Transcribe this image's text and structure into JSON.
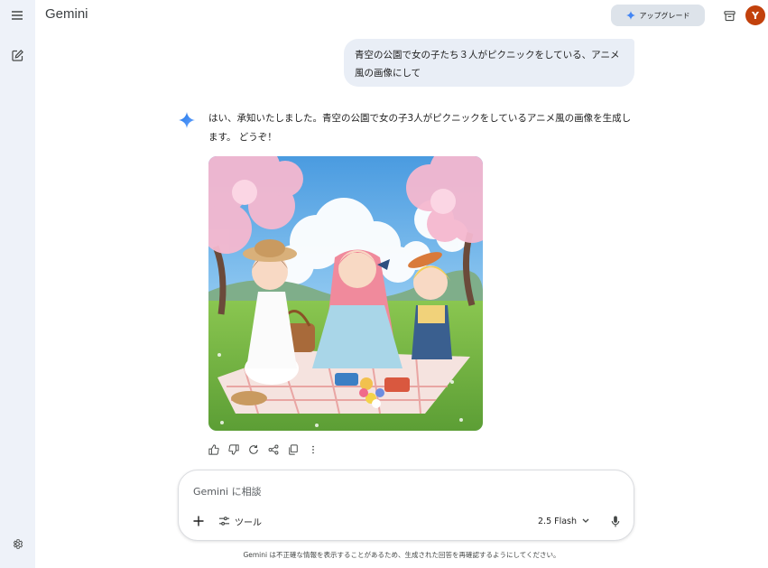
{
  "app": {
    "title": "Gemini"
  },
  "header": {
    "upgrade_label": "アップグレード",
    "avatar_initial": "Y",
    "avatar_color": "#c2410c"
  },
  "conversation": {
    "user_message": "青空の公園で女の子たち３人がピクニックをしている、アニメ風の画像にして",
    "model_response": "はい、承知いたしました。青空の公園で女の子3人がピクニックをしているアニメ風の画像を生成します。 どうぞ！",
    "image_icon": "generated-image"
  },
  "actions": [
    "thumb-up-icon",
    "thumb-down-icon",
    "regenerate-icon",
    "share-icon",
    "copy-icon",
    "more-icon"
  ],
  "input": {
    "placeholder": "Gemini に相談",
    "tools_label": "ツール",
    "model_label": "2.5 Flash"
  },
  "footer": {
    "disclaimer": "Gemini は不正確な情報を表示することがあるため、生成された回答を再確認するようにしてください。"
  },
  "colors": {
    "sidebar_bg": "#eef2f9",
    "bubble_bg": "#e9eef6",
    "upgrade_bg": "#dde3ea",
    "accent": "#4285f4"
  }
}
